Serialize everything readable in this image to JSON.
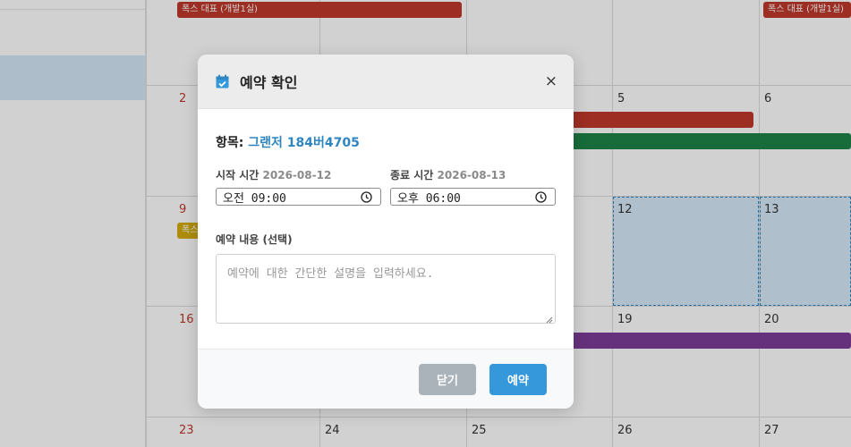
{
  "calendar": {
    "days": [
      {
        "label": "2",
        "sunday": true
      },
      {
        "label": "5",
        "sunday": false
      },
      {
        "label": "6",
        "sunday": false
      },
      {
        "label": "9",
        "sunday": true
      },
      {
        "label": "12",
        "sunday": false
      },
      {
        "label": "13",
        "sunday": false
      },
      {
        "label": "16",
        "sunday": true
      },
      {
        "label": "19",
        "sunday": false
      },
      {
        "label": "20",
        "sunday": false
      },
      {
        "label": "23",
        "sunday": true
      },
      {
        "label": "24",
        "sunday": false
      },
      {
        "label": "25",
        "sunday": false
      },
      {
        "label": "26",
        "sunday": false
      },
      {
        "label": "27",
        "sunday": false
      }
    ],
    "events": [
      {
        "label": "폭스 대표 (개발1실)",
        "color": "#c0392b"
      },
      {
        "label": "폭스 대표 (개발1실)",
        "color": "#c0392b"
      },
      {
        "label": "폭스",
        "color": "#d4ac0d"
      }
    ]
  },
  "modal": {
    "title": "예약 확인",
    "close_symbol": "×",
    "item_label": "항목:",
    "item_value": "그랜저 184버4705",
    "start": {
      "label": "시작 시간",
      "date": "2026-08-12",
      "time": "오전 09:00"
    },
    "end": {
      "label": "종료 시간",
      "date": "2026-08-13",
      "time": "오후 06:00"
    },
    "description": {
      "label": "예약 내용 (선택)",
      "placeholder": "예약에 대한 간단한 설명을 입력하세요."
    },
    "buttons": {
      "close": "닫기",
      "reserve": "예약"
    }
  },
  "icons": {
    "calendar": "calendar-check-icon",
    "clock": "clock-icon",
    "close": "close-icon"
  },
  "colors": {
    "accent": "#3498db",
    "item_value": "#2e86c1",
    "close_button": "#aab3ba"
  }
}
